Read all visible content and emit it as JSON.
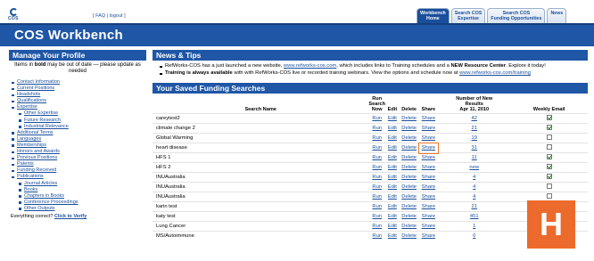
{
  "top": {
    "logo_text": "COS",
    "faq": "FAQ",
    "logout": "logout",
    "tabs": [
      {
        "line1": "Workbench",
        "line2": "Home",
        "active": true
      },
      {
        "line1": "Search COS",
        "line2": "Expertise",
        "active": false
      },
      {
        "line1": "Search COS",
        "line2": "Funding Opportunities",
        "active": false
      },
      {
        "line1": "News",
        "line2": "",
        "active": false
      }
    ]
  },
  "header": {
    "title": "COS Workbench"
  },
  "sidebar": {
    "title": "Manage Your Profile",
    "note_bold": "bold",
    "note_pre": "Items in ",
    "note_post": " may be out of date — please update as needed",
    "items": [
      {
        "label": "Contact Information",
        "sub": false
      },
      {
        "label": "Current Positions",
        "sub": false
      },
      {
        "label": "Headshots",
        "sub": false
      },
      {
        "label": "Qualifications",
        "sub": false
      },
      {
        "label": "Expertise",
        "sub": false
      },
      {
        "label": "Other Expertise",
        "sub": true
      },
      {
        "label": "Future Research",
        "sub": true
      },
      {
        "label": "Industrial Relevance",
        "sub": true
      },
      {
        "label": "Additional Terms",
        "sub": false
      },
      {
        "label": "Languages",
        "sub": false
      },
      {
        "label": "Memberships",
        "sub": false
      },
      {
        "label": "Honors and Awards",
        "sub": false
      },
      {
        "label": "Previous Positions",
        "sub": false
      },
      {
        "label": "Patents",
        "sub": false
      },
      {
        "label": "Funding Received",
        "sub": false
      },
      {
        "label": "Publications",
        "sub": false
      },
      {
        "label": "Journal Articles",
        "sub": true
      },
      {
        "label": "Books",
        "sub": true
      },
      {
        "label": "Chapters in Books",
        "sub": true
      },
      {
        "label": "Conference Proceedings",
        "sub": true
      },
      {
        "label": "Other Outputs",
        "sub": true
      }
    ],
    "footer_text": "Everything correct? ",
    "footer_link": "Click to Verify"
  },
  "news": {
    "title": "News & Tips",
    "item1": {
      "lead": "RefWorks-COS has a just launched a new website,",
      "link": "www.refworks-cos.com",
      "mid": ", which includes links to Training schedules and a ",
      "bold": "NEW Resource Center",
      "tail": ". Explore it today!"
    },
    "item2": {
      "bold": "Training is always available",
      "mid": " with with RefWorks-COS live or recorded training webinars. View the options and schedule now at ",
      "link": "www.refworks-cos.com/training"
    }
  },
  "searches": {
    "title": "Your Saved Funding Searches",
    "headers": {
      "name": "Search Name",
      "run": "Run Search Now",
      "edit": "Edit",
      "delete": "Delete",
      "share": "Share",
      "count": "Number of New Results Apr 11, 2010",
      "weekly": "Weekly Email"
    },
    "action_labels": {
      "run": "Run",
      "edit": "Edit",
      "delete": "Delete",
      "share": "Share"
    },
    "rows": [
      {
        "name": "careytest2",
        "count": "42",
        "weekly": true
      },
      {
        "name": "climate change 2",
        "count": "21",
        "weekly": true
      },
      {
        "name": "Global Warming",
        "count": "19",
        "weekly": false
      },
      {
        "name": "heart disease",
        "count": "31",
        "weekly": false,
        "highlight_share": true
      },
      {
        "name": "HFS 1",
        "count": "11",
        "weekly": true
      },
      {
        "name": "HFS 2",
        "count": "new",
        "weekly": true
      },
      {
        "name": "INUAustralia",
        "count": "4",
        "weekly": true
      },
      {
        "name": "INUAustralia",
        "count": "4",
        "weekly": false
      },
      {
        "name": "INUAustralia",
        "count": "4",
        "weekly": false
      },
      {
        "name": "karin test",
        "count": "21",
        "weekly": false
      },
      {
        "name": "katy test",
        "count": "451",
        "weekly": false
      },
      {
        "name": "Lung Cancer",
        "count": "1",
        "weekly": false
      },
      {
        "name": "MS/Autoimmune",
        "count": "0",
        "weekly": false
      }
    ]
  },
  "badge": {
    "letter": "H",
    "color": "#ec6a2c"
  },
  "colors": {
    "brand": "#1f56a6",
    "link": "#1a4f9c"
  }
}
